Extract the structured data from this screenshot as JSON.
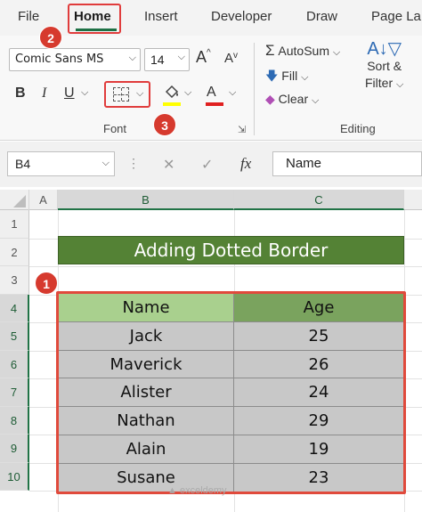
{
  "ribbon_tabs": {
    "file": "File",
    "home": "Home",
    "insert": "Insert",
    "developer": "Developer",
    "draw": "Draw",
    "page_layout": "Page La"
  },
  "font_group": {
    "font_name": "Comic Sans MS",
    "font_size": "14",
    "grow_font": "A",
    "shrink_font": "A",
    "bold": "B",
    "italic": "I",
    "underline": "U",
    "font_color": "A",
    "label": "Font",
    "fill_color_hex": "#ffff00",
    "font_color_hex": "#e02020",
    "border_icon": "borders-icon"
  },
  "editing_group": {
    "autosum": "AutoSum",
    "fill": "Fill",
    "clear": "Clear",
    "sort_filter_line1": "Sort &",
    "sort_filter_line2": "Filter",
    "label": "Editing"
  },
  "steps": [
    "1",
    "2",
    "3"
  ],
  "formula_bar": {
    "name_box": "B4",
    "formula": "Name"
  },
  "grid": {
    "columns": [
      "A",
      "B",
      "C"
    ],
    "rows": [
      "1",
      "2",
      "3",
      "4",
      "5",
      "6",
      "7",
      "8",
      "9",
      "10"
    ],
    "title": "Adding Dotted Border",
    "title_bg": "#548235",
    "headers": [
      "Name",
      "Age"
    ],
    "data": [
      {
        "name": "Jack",
        "age": "25"
      },
      {
        "name": "Maverick",
        "age": "26"
      },
      {
        "name": "Alister",
        "age": "24"
      },
      {
        "name": "Nathan",
        "age": "29"
      },
      {
        "name": "Alain",
        "age": "19"
      },
      {
        "name": "Susane",
        "age": "23"
      }
    ]
  },
  "watermark": "exceldemy"
}
